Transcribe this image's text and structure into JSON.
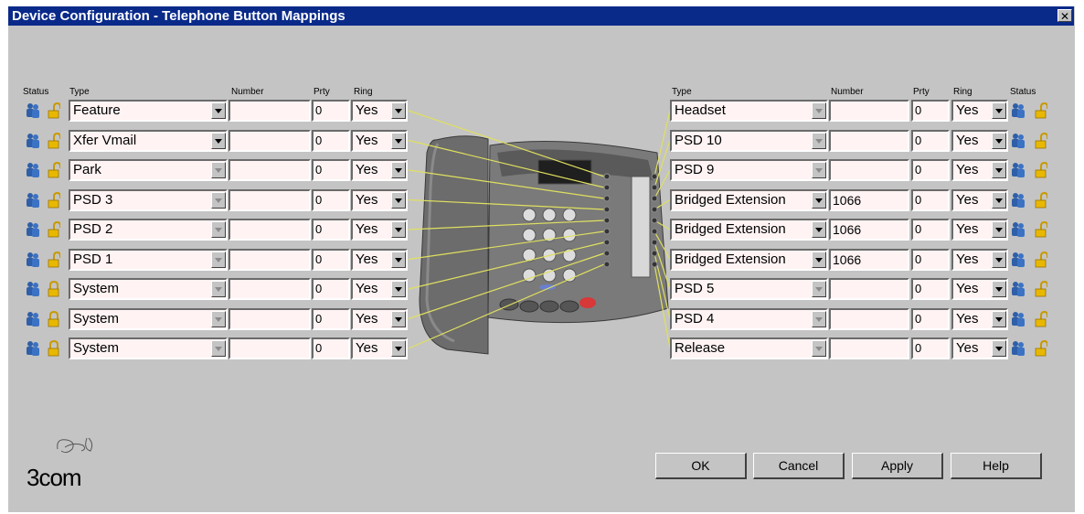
{
  "window": {
    "title": "Device Configuration - Telephone Button Mappings",
    "close_label": "✕"
  },
  "left_headers": {
    "status": "Status",
    "type": "Type",
    "number": "Number",
    "prty": "Prty",
    "ring": "Ring"
  },
  "right_headers": {
    "type": "Type",
    "number": "Number",
    "prty": "Prty",
    "ring": "Ring",
    "status": "Status"
  },
  "left_rows": [
    {
      "type": "Feature",
      "number": "",
      "prty": "0",
      "ring": "Yes",
      "lock": "open"
    },
    {
      "type": "Xfer Vmail",
      "number": "",
      "prty": "0",
      "ring": "Yes",
      "lock": "open"
    },
    {
      "type": "Park",
      "number": "",
      "prty": "0",
      "ring": "Yes",
      "lock": "open"
    },
    {
      "type": "PSD 3",
      "number": "",
      "prty": "0",
      "ring": "Yes",
      "lock": "open"
    },
    {
      "type": "PSD 2",
      "number": "",
      "prty": "0",
      "ring": "Yes",
      "lock": "open"
    },
    {
      "type": "PSD 1",
      "number": "",
      "prty": "0",
      "ring": "Yes",
      "lock": "open"
    },
    {
      "type": "System",
      "number": "",
      "prty": "0",
      "ring": "Yes",
      "lock": "closed"
    },
    {
      "type": "System",
      "number": "",
      "prty": "0",
      "ring": "Yes",
      "lock": "closed"
    },
    {
      "type": "System",
      "number": "",
      "prty": "0",
      "ring": "Yes",
      "lock": "closed"
    }
  ],
  "right_rows": [
    {
      "type": "Headset",
      "number": "",
      "prty": "0",
      "ring": "Yes",
      "lock": "open"
    },
    {
      "type": "PSD 10",
      "number": "",
      "prty": "0",
      "ring": "Yes",
      "lock": "open"
    },
    {
      "type": "PSD 9",
      "number": "",
      "prty": "0",
      "ring": "Yes",
      "lock": "open"
    },
    {
      "type": "Bridged Extension",
      "number": "1066",
      "prty": "0",
      "ring": "Yes",
      "lock": "open"
    },
    {
      "type": "Bridged Extension",
      "number": "1066",
      "prty": "0",
      "ring": "Yes",
      "lock": "open"
    },
    {
      "type": "Bridged Extension",
      "number": "1066",
      "prty": "0",
      "ring": "Yes",
      "lock": "open"
    },
    {
      "type": "PSD 5",
      "number": "",
      "prty": "0",
      "ring": "Yes",
      "lock": "open"
    },
    {
      "type": "PSD 4",
      "number": "",
      "prty": "0",
      "ring": "Yes",
      "lock": "open"
    },
    {
      "type": "Release",
      "number": "",
      "prty": "0",
      "ring": "Yes",
      "lock": "open"
    }
  ],
  "buttons": {
    "ok": "OK",
    "cancel": "Cancel",
    "apply": "Apply",
    "help": "Help"
  },
  "logo": {
    "text": "3com"
  },
  "icons": {
    "status": "users-icon",
    "lock_open": "lock-open-icon",
    "lock_closed": "lock-closed-icon",
    "phone": "telephone-image"
  },
  "colors": {
    "title_bar": "#0a2a8a",
    "window_bg": "#c4c4c4",
    "field_bg": "#fff3f3",
    "connector": "#e0e060",
    "user_icon": "#2f5fa8",
    "lock": "#e0b000"
  }
}
